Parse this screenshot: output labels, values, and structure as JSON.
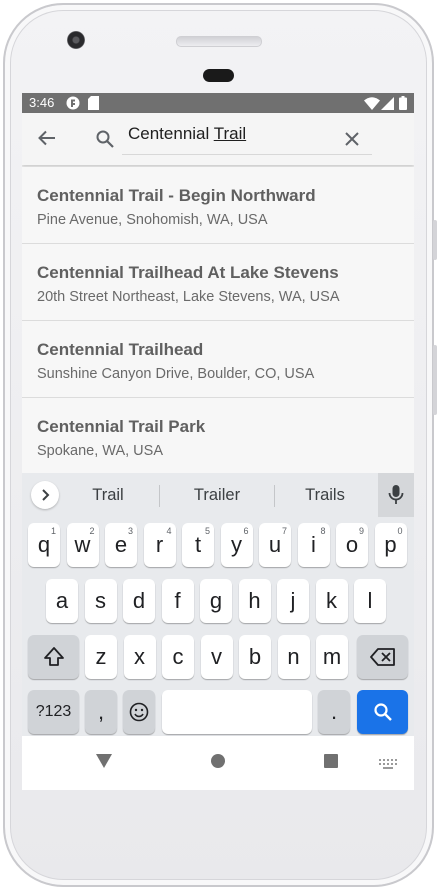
{
  "status_bar": {
    "time": "3:46",
    "icons": [
      "app-notification-icon",
      "sd-card-icon",
      "wifi-icon",
      "signal-icon",
      "battery-icon"
    ]
  },
  "search": {
    "query_prefix": "Centennial ",
    "query_underlined": "Trail",
    "back_icon": "arrow-left-icon",
    "search_icon": "search-icon",
    "clear_icon": "close-icon"
  },
  "results": [
    {
      "title": "Centennial Trail - Begin Northward",
      "subtitle": "Pine Avenue, Snohomish, WA, USA"
    },
    {
      "title": "Centennial Trailhead At Lake Stevens",
      "subtitle": "20th Street Northeast, Lake Stevens, WA, USA"
    },
    {
      "title": "Centennial Trailhead",
      "subtitle": "Sunshine Canyon Drive, Boulder, CO, USA"
    },
    {
      "title": "Centennial Trail Park",
      "subtitle": "Spokane, WA, USA"
    }
  ],
  "keyboard": {
    "suggestions": [
      "Trail",
      "Trailer",
      "Trails"
    ],
    "row1": [
      "q",
      "w",
      "e",
      "r",
      "t",
      "y",
      "u",
      "i",
      "o",
      "p"
    ],
    "row1_hints": [
      "1",
      "2",
      "3",
      "4",
      "5",
      "6",
      "7",
      "8",
      "9",
      "0"
    ],
    "row2": [
      "a",
      "s",
      "d",
      "f",
      "g",
      "h",
      "j",
      "k",
      "l"
    ],
    "row3": [
      "z",
      "x",
      "c",
      "v",
      "b",
      "n",
      "m"
    ],
    "symbols_label": "?123",
    "comma_label": ",",
    "period_label": ".",
    "space_label": "",
    "accent_color": "#1a73e8"
  },
  "nav": {
    "back_icon": "triangle-back-icon",
    "home_icon": "circle-home-icon",
    "recents_icon": "square-recents-icon",
    "keyboard_switch_icon": "keyboard-icon"
  }
}
